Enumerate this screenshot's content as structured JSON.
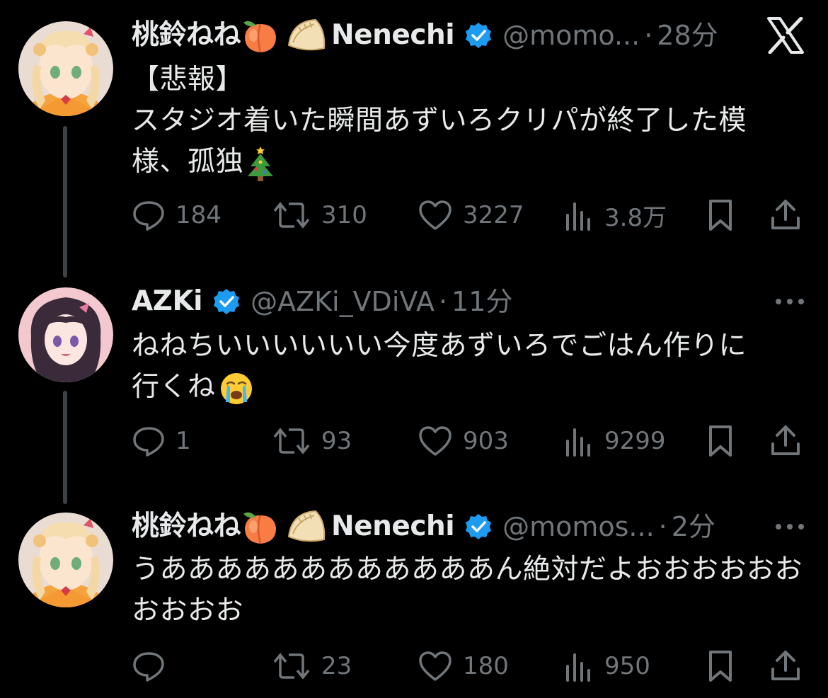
{
  "posts": [
    {
      "display_name": "桃鈴ねね",
      "name_suffix": "Nenechi",
      "handle": "@momo...",
      "separator": "·",
      "time": "28分",
      "body_line1": "【悲報】",
      "body_line2": "スタジオ着いた瞬間あずいろクリパが終了した模",
      "body_line3": "様、孤独",
      "body_emoji": "tree-emoji",
      "replies": "184",
      "reposts": "310",
      "likes": "3227",
      "views": "3.8万"
    },
    {
      "display_name": "AZKi",
      "handle": "@AZKi_VDiVA",
      "separator": "·",
      "time": "11分",
      "body_line1": "ねねちいいいいいい今度あずいろでごはん作りに",
      "body_line2": "行くね",
      "body_emoji": "crying-face-emoji",
      "replies": "1",
      "reposts": "93",
      "likes": "903",
      "views": "9299"
    },
    {
      "display_name": "桃鈴ねね",
      "name_suffix": "Nenechi",
      "handle": "@momos...",
      "separator": "·",
      "time": "2分",
      "body_line1": "うああああああああああああん絶対だよおおおおおお",
      "body_line2": "おおおお",
      "replies": "",
      "reposts": "23",
      "likes": "180",
      "views": "950"
    }
  ],
  "icons": [
    "x-logo-icon",
    "more-icon",
    "reply-icon",
    "repost-icon",
    "like-icon",
    "views-icon",
    "bookmark-icon",
    "share-icon",
    "verified-badge-icon",
    "peach-emoji",
    "dumpling-emoji"
  ],
  "colors": {
    "background": "#000000",
    "text": "#e7e9ea",
    "muted": "#71767b",
    "verified": "#1d9bf0",
    "thread_line": "#3e4144"
  }
}
